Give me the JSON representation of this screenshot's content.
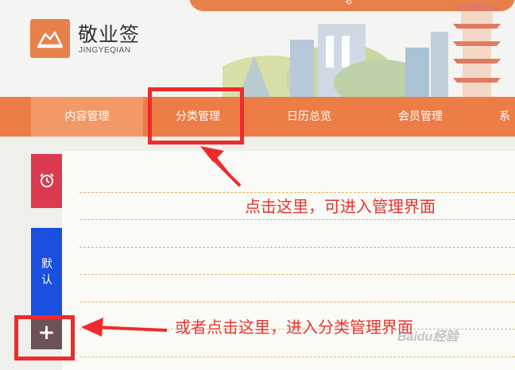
{
  "app": {
    "brand": "敬业签",
    "brand_sub": "JINGYEQIAN"
  },
  "nav": {
    "items": [
      {
        "label": "内容管理",
        "active": true
      },
      {
        "label": "分类管理",
        "active": false
      },
      {
        "label": "日历总览",
        "active": false
      },
      {
        "label": "会员管理",
        "active": false
      },
      {
        "label": "系",
        "active": false
      }
    ]
  },
  "sidebar": {
    "tabs": [
      {
        "icon": "alarm-clock-icon",
        "color": "#dc3a51"
      },
      {
        "label": "默认",
        "color": "#1b4fe0"
      }
    ],
    "add_label": "+"
  },
  "annotations": {
    "note_nav": "点击这里，可进入管理界面",
    "note_add": "或者点击这里，进入分类管理界面"
  },
  "watermark": "Baidu经验",
  "colors": {
    "accent": "#ec7d47",
    "annotation": "#ee2b2b"
  }
}
